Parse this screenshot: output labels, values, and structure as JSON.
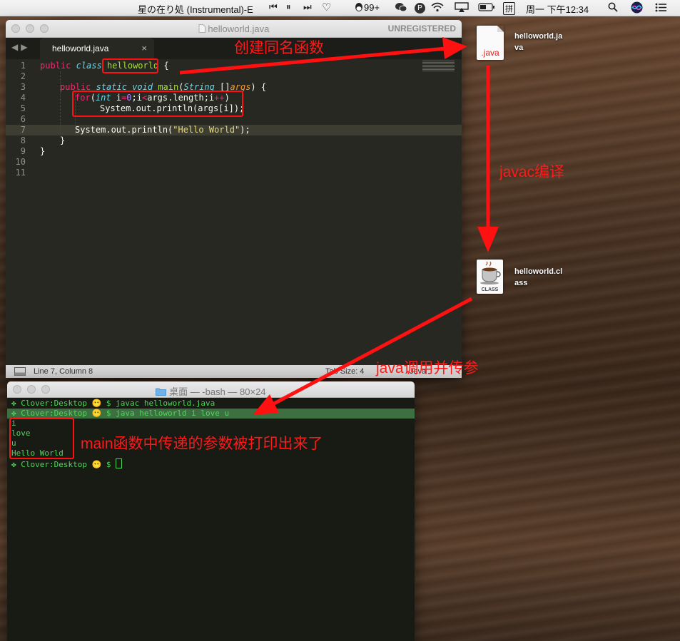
{
  "menubar": {
    "song": "星の在り処 (Instrumental)-E",
    "prev": "⏮",
    "pause": "⏸",
    "next": "⏭",
    "heart": "♡",
    "qq_count": "99+",
    "p_badge": "P",
    "input_method": "拼",
    "clock": "周一 下午12:34"
  },
  "sublime": {
    "title": "helloworld.java",
    "unregistered": "UNREGISTERED",
    "tab_label": "helloworld.java",
    "tab_close": "×",
    "line_numbers": [
      "1",
      "2",
      "3",
      "4",
      "5",
      "6",
      "7",
      "8",
      "9",
      "10",
      "11"
    ],
    "status_position": "Line 7, Column 8",
    "status_tab": "Tab Size: 4",
    "status_syntax": "Java"
  },
  "code": {
    "l1_kw": "public",
    "l1_cls": "class",
    "l1_name": "helloworld",
    "l1_brace": " {",
    "l3_kw": "public",
    "l3_static": "static",
    "l3_void": "void",
    "l3_fn": "main",
    "l3_type": "String",
    "l3_mid": " []",
    "l3_param": "args",
    "l3_end": ") {",
    "l4_for": "for",
    "l4_int": "int",
    "l4_a": " i",
    "l4_eq": "=",
    "l4_zero": "0",
    "l4_b": ";i",
    "l4_lt": "<",
    "l4_c": "args.length;i",
    "l4_pp": "++",
    "l4_d": ")",
    "l5": "System.out.println(args[i]);",
    "l7_a": "System.out.println(",
    "l7_str": "\"Hello World\"",
    "l7_b": ");",
    "l8": "}",
    "l9": "}"
  },
  "terminal": {
    "title": "桌面 — -bash — 80×24",
    "lines": [
      "Clover:Desktop 😶 $ javac helloworld.java",
      "Clover:Desktop 😶 $ java helloworld i love u",
      "i",
      "love",
      "u",
      "Hello World",
      "Clover:Desktop 😶 $ "
    ]
  },
  "desktop": {
    "java_file": "helloworld.ja\nva",
    "java_badge": ".java",
    "class_file": "helloworld.cl\nass",
    "class_badge": "CLASS"
  },
  "annotations": {
    "create": "创建同名函数",
    "compile": "javac编译",
    "invoke": "java调用并传参",
    "result": "main函数中传递的参数被打印出来了"
  }
}
